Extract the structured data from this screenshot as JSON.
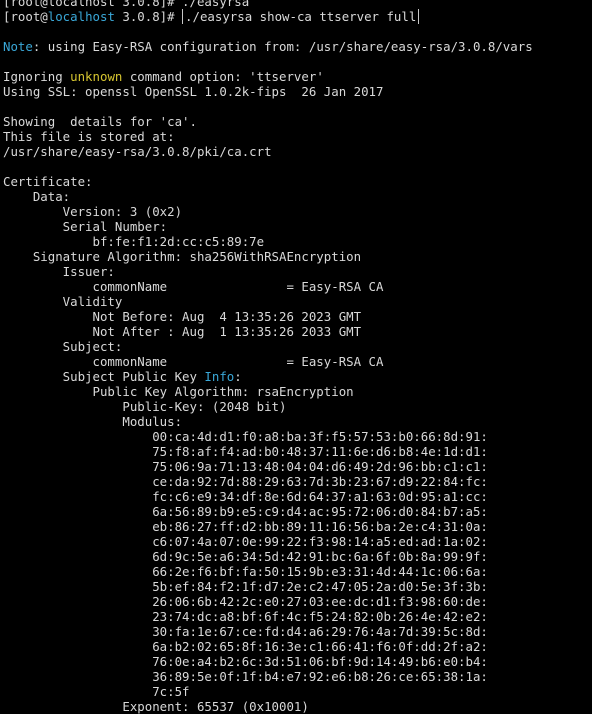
{
  "colors": {
    "background": "#000000",
    "text": "#d9d9d9",
    "note_label": "#3aa8d8",
    "highlight_yellow": "#d6c530",
    "info_highlight": "#3aa8d8"
  },
  "prompt": {
    "top_partial": "[root@localhost 3.0.8]# ./easyrsa",
    "user_open": "[root@",
    "host": "localhost",
    "rest": " 3.0.8]# ",
    "command": "./easyrsa show-ca ttserver full"
  },
  "output": {
    "note_label": "Note",
    "note_text": ": using Easy-RSA configuration from: /usr/share/easy-rsa/3.0.8/vars",
    "ignoring_pre": "Ignoring ",
    "ignoring_word": "unknown",
    "ignoring_post": " command option: 'ttserver'",
    "ssl_line": "Using SSL: openssl OpenSSL 1.0.2k-fips  26 Jan 2017",
    "showing_line": "Showing  details for 'ca'.",
    "stored_line": "This file is stored at:",
    "path_line": "/usr/share/easy-rsa/3.0.8/pki/ca.crt",
    "certificate": "Certificate:",
    "data": "    Data:",
    "version": "        Version: 3 (0x2)",
    "serial_label": "        Serial Number:",
    "serial_value": "            bf:fe:f1:2d:cc:c5:89:7e",
    "sig_alg": "    Signature Algorithm: sha256WithRSAEncryption",
    "issuer": "        Issuer:",
    "issuer_cn": "            commonName                = Easy-RSA CA",
    "validity": "        Validity",
    "not_before": "            Not Before: Aug  4 13:35:26 2023 GMT",
    "not_after": "            Not After : Aug  1 13:35:26 2033 GMT",
    "subject": "        Subject:",
    "subject_cn": "            commonName                = Easy-RSA CA",
    "spki_pre": "        Subject Public Key ",
    "spki_info": "Info",
    "spki_post": ":",
    "pk_alg": "            Public Key Algorithm: rsaEncryption",
    "pk_size": "                Public-Key: (2048 bit)",
    "modulus_label": "                Modulus:",
    "modulus": [
      "                    00:ca:4d:d1:f0:a8:ba:3f:f5:57:53:b0:66:8d:91:",
      "                    75:f8:af:f4:ad:b0:48:37:11:6e:d6:b8:4e:1d:d1:",
      "                    75:06:9a:71:13:48:04:04:d6:49:2d:96:bb:c1:c1:",
      "                    ce:da:92:7d:88:29:63:7d:3b:23:67:d9:22:84:fc:",
      "                    fc:c6:e9:34:df:8e:6d:64:37:a1:63:0d:95:a1:cc:",
      "                    6a:56:89:b9:e5:c9:d4:ac:95:72:06:d0:84:b7:a5:",
      "                    eb:86:27:ff:d2:bb:89:11:16:56:ba:2e:c4:31:0a:",
      "                    c6:07:4a:07:0e:99:22:f3:98:14:a5:ed:ad:1a:02:",
      "                    6d:9c:5e:a6:34:5d:42:91:bc:6a:6f:0b:8a:99:9f:",
      "                    66:2e:f6:bf:fa:50:15:9b:e3:31:4d:44:1c:06:6a:",
      "                    5b:ef:84:f2:1f:d7:2e:c2:47:05:2a:d0:5e:3f:3b:",
      "                    26:06:6b:42:2c:e0:27:03:ee:dc:d1:f3:98:60:de:",
      "                    23:74:dc:a8:bf:6f:4c:f5:24:82:0b:26:4e:42:e2:",
      "                    30:fa:1e:67:ce:fd:d4:a6:29:76:4a:7d:39:5c:8d:",
      "                    6a:b2:02:65:8f:16:3e:c1:66:41:f6:0f:dd:2f:a2:",
      "                    76:0e:a4:b2:6c:3d:51:06:bf:9d:14:49:b6:e0:b4:",
      "                    36:89:5e:0f:1f:b4:e7:92:e6:b8:26:ce:65:38:1a:",
      "                    7c:5f"
    ],
    "exponent": "                Exponent: 65537 (0x10001)"
  }
}
